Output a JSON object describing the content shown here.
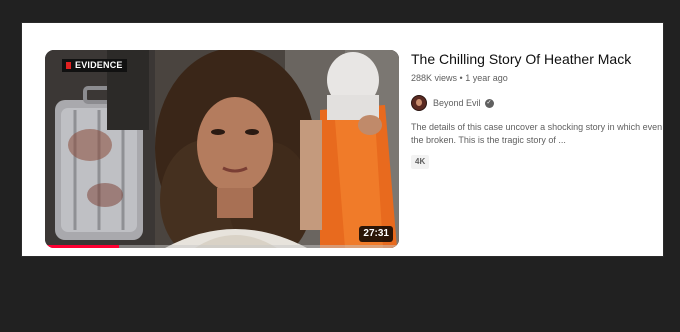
{
  "video": {
    "thumbnail_tag": "EVIDENCE",
    "duration": "27:31",
    "progress_fraction": 0.21,
    "title": "The Chilling Story Of Heather Mack",
    "views": "288K views",
    "separator": "•",
    "age": "1 year ago",
    "channel": "Beyond Evil",
    "description": "The details of this case uncover a shocking story in which even the broken. This is the tragic story of ...",
    "badge": "4K"
  },
  "colors": {
    "background": "#212121",
    "card": "#ffffff",
    "progress": "#ff0033",
    "title": "#0f0f0f",
    "meta": "#606060"
  },
  "icons": {
    "verified": "check-circle-icon",
    "evidence_marker": "red-square-icon"
  }
}
